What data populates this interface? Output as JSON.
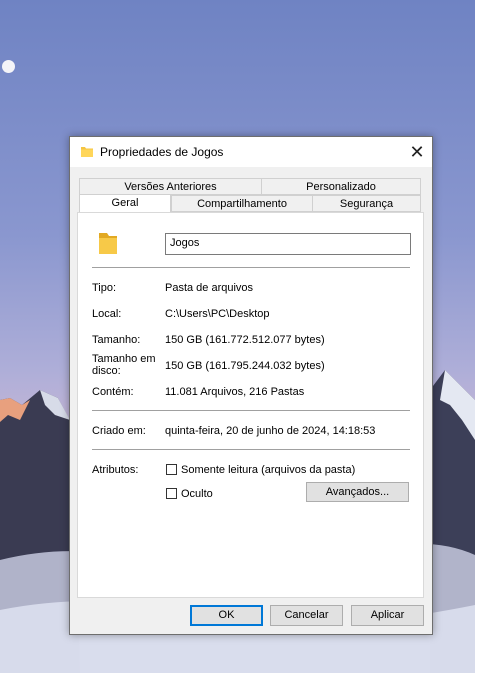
{
  "dialog": {
    "title": "Propriedades de Jogos",
    "close_glyph": "✕",
    "tabs_top": [
      "Versões Anteriores",
      "Personalizado"
    ],
    "tabs_bottom": [
      "Geral",
      "Compartilhamento",
      "Segurança"
    ],
    "active_tab": "Geral"
  },
  "general": {
    "name_value": "Jogos",
    "type_label": "Tipo:",
    "type_value": "Pasta de arquivos",
    "location_label": "Local:",
    "location_value": "C:\\Users\\PC\\Desktop",
    "size_label": "Tamanho:",
    "size_value": "150 GB (161.772.512.077 bytes)",
    "disk_size_label_line1": "Tamanho em",
    "disk_size_label_line2": "disco:",
    "disk_size_value": "150 GB (161.795.244.032 bytes)",
    "contains_label": "Contém:",
    "contains_value": "11.081 Arquivos, 216 Pastas",
    "created_label": "Criado em:",
    "created_value": "quinta-feira, 20 de junho de 2024, 14:18:53",
    "attributes_label": "Atributos:",
    "readonly_label": "Somente leitura (arquivos da pasta)",
    "readonly_checked": false,
    "hidden_label": "Oculto",
    "hidden_checked": false,
    "advanced_button": "Avançados..."
  },
  "buttons": {
    "ok": "OK",
    "cancel": "Cancelar",
    "apply": "Aplicar"
  },
  "colors": {
    "folder": "#f5c542",
    "accent": "#0078d7"
  },
  "icons": {
    "title": "folder-icon",
    "close": "close-icon",
    "large": "folder-icon"
  }
}
